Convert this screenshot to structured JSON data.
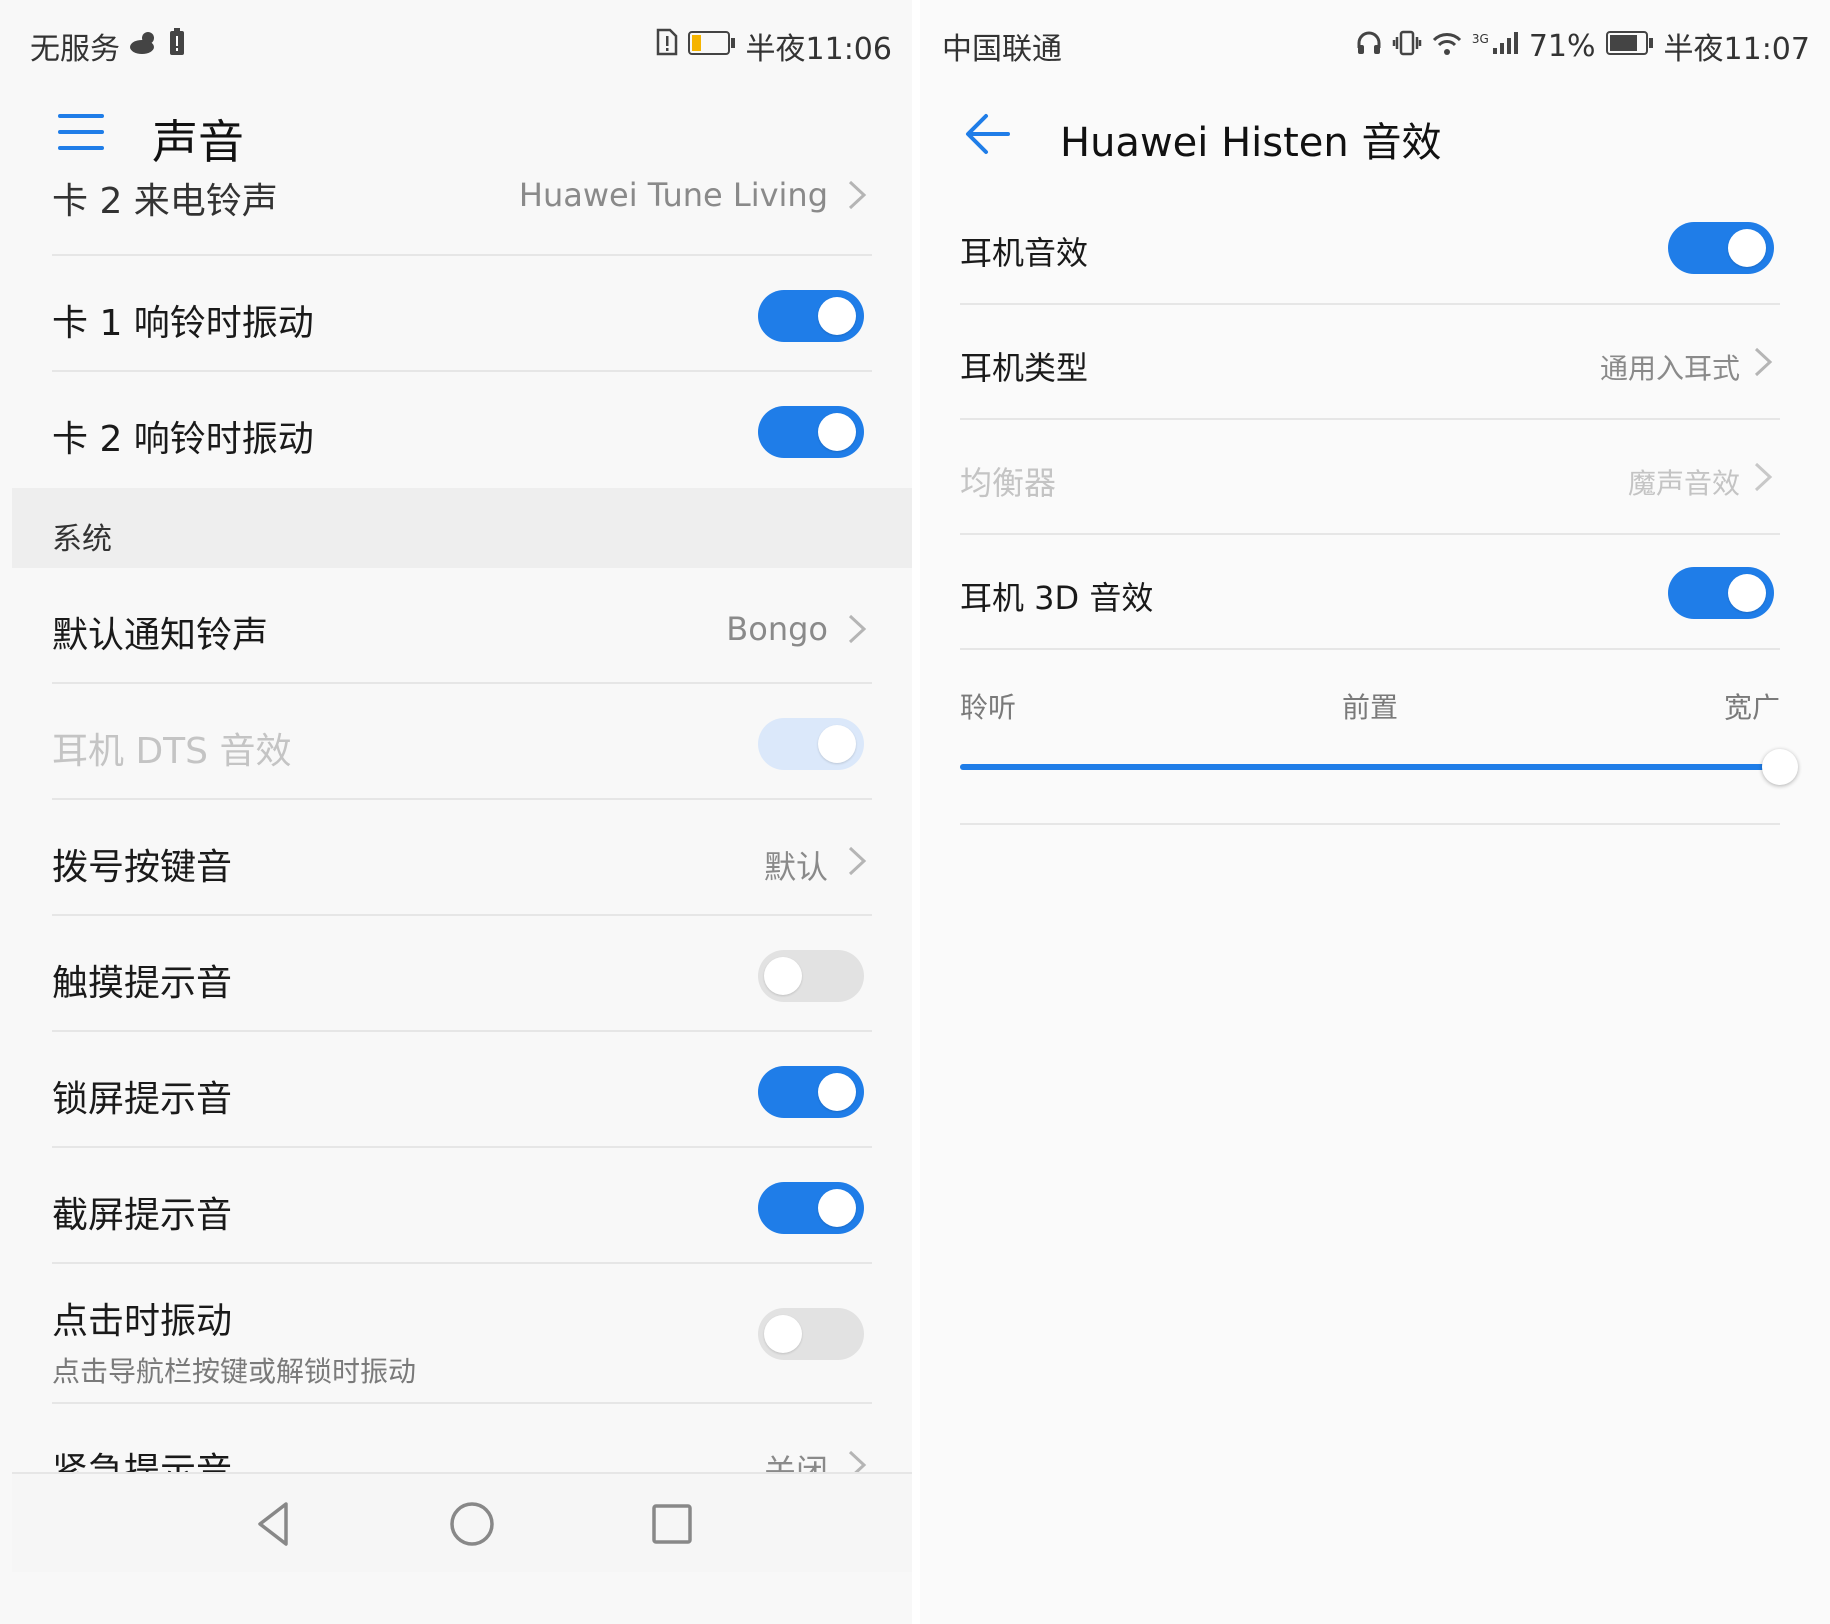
{
  "left": {
    "status": {
      "carrier": "无服务",
      "time": "半夜11:06"
    },
    "title": "声音",
    "partial_row": {
      "label": "卡 2 来电铃声",
      "value": "Huawei Tune Living"
    },
    "rows_top": [
      {
        "label": "卡 1 响铃时振动",
        "toggle": "on"
      },
      {
        "label": "卡 2 响铃时振动",
        "toggle": "on"
      }
    ],
    "section_system": "系统",
    "default_notification": {
      "label": "默认通知铃声",
      "value": "Bongo"
    },
    "dts": {
      "label": "耳机 DTS 音效",
      "toggle": "on-disabled"
    },
    "dial_tone": {
      "label": "拨号按键音",
      "value": "默认"
    },
    "touch_tone": {
      "label": "触摸提示音",
      "toggle": "off"
    },
    "lock_tone": {
      "label": "锁屏提示音",
      "toggle": "on"
    },
    "screenshot_tone": {
      "label": "截屏提示音",
      "toggle": "on"
    },
    "tap_vibrate": {
      "label": "点击时振动",
      "sub": "点击导航栏按键或解锁时振动",
      "toggle": "off"
    },
    "emergency": {
      "label": "紧急提示音",
      "value": "关闭"
    }
  },
  "right": {
    "status": {
      "carrier": "中国联通",
      "network": "3G",
      "battery": "71%",
      "time": "半夜11:07"
    },
    "title": "Huawei Histen 音效",
    "headset_effect": {
      "label": "耳机音效",
      "toggle": "on"
    },
    "headset_type": {
      "label": "耳机类型",
      "value": "通用入耳式"
    },
    "equalizer": {
      "label": "均衡器",
      "value": "魔声音效"
    },
    "effect_3d": {
      "label": "耳机 3D 音效",
      "toggle": "on"
    },
    "slider": {
      "left_label": "聆听",
      "mid_label": "前置",
      "right_label": "宽广",
      "value": 1.0
    }
  },
  "colors": {
    "accent": "#1f7de8",
    "toggle_off": "#e2e2e2",
    "disabled_text": "#c4c4c4"
  }
}
